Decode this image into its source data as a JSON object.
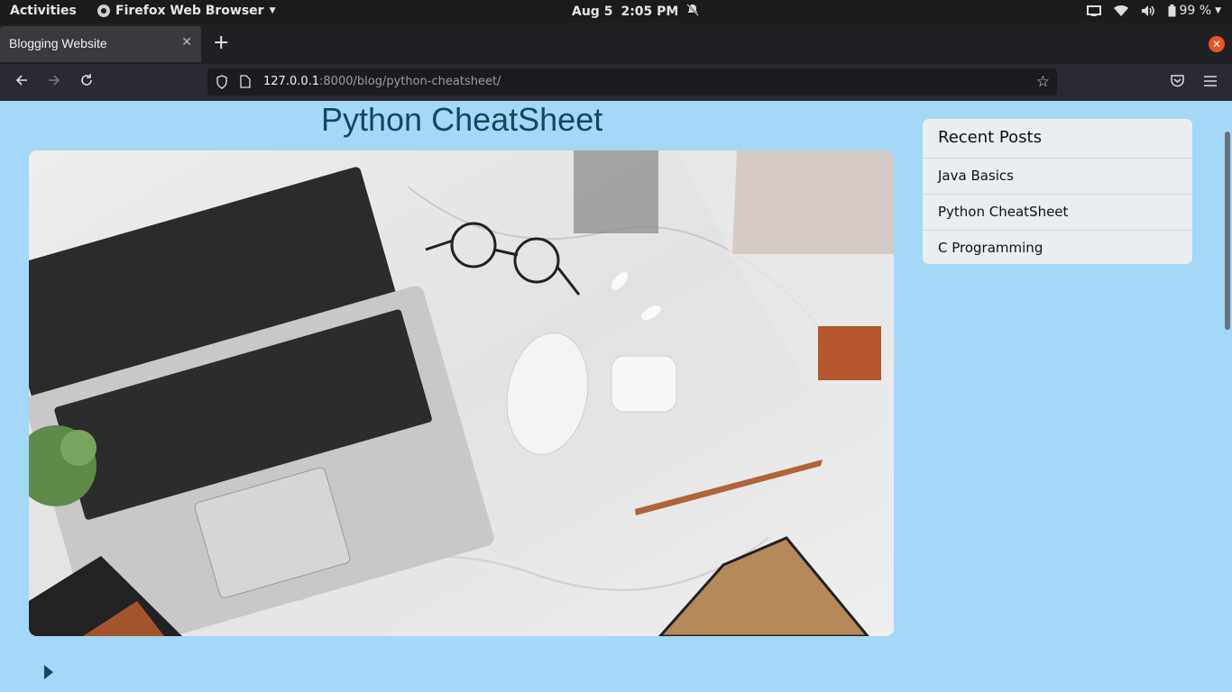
{
  "system": {
    "activities": "Activities",
    "app_name": "Firefox Web Browser",
    "date": "Aug 5",
    "time": "2:05 PM",
    "battery": "99 %"
  },
  "browser": {
    "tab_title": "Blogging Website",
    "url_host": "127.0.0.1",
    "url_rest": ":8000/blog/python-cheatsheet/"
  },
  "page": {
    "title": "Python CheatSheet",
    "sidebar_heading": "Recent Posts",
    "recent_posts": [
      "Java Basics",
      "Python CheatSheet",
      "C Programming"
    ]
  },
  "colors": {
    "page_background": "#a4d8f7",
    "title_color": "#0f4a60",
    "accent_orange": "#e95420"
  }
}
